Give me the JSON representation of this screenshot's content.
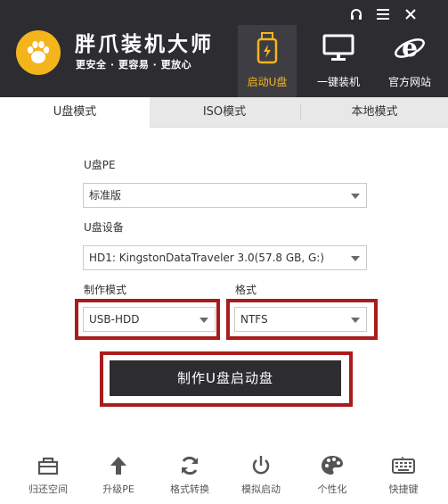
{
  "app": {
    "title": "胖爪装机大师",
    "tagline": "更安全 · 更容易 · 更放心",
    "brand_color": "#f3b51b",
    "header_color": "#2d2c31"
  },
  "window_controls": [
    {
      "icon": "headset-icon"
    },
    {
      "icon": "menu-icon"
    },
    {
      "icon": "close-icon"
    }
  ],
  "nav": [
    {
      "label": "启动U盘",
      "icon": "usb-drive-icon",
      "active": true
    },
    {
      "label": "一键装机",
      "icon": "monitor-icon",
      "active": false
    },
    {
      "label": "官方网站",
      "icon": "ie-browser-icon",
      "active": false
    }
  ],
  "tabs": [
    {
      "label": "U盘模式",
      "active": true
    },
    {
      "label": "ISO模式",
      "active": false
    },
    {
      "label": "本地模式",
      "active": false
    }
  ],
  "form": {
    "pe_label": "U盘PE",
    "pe_value": "标准版",
    "device_label": "U盘设备",
    "device_value": "HD1: KingstonDataTraveler 3.0(57.8 GB, G:)",
    "mode_label": "制作模式",
    "mode_value": "USB-HDD",
    "format_label": "格式",
    "format_value": "NTFS",
    "highlight_color": "#a81c1c"
  },
  "make_button": "制作U盘启动盘",
  "tools": [
    {
      "label": "归还空间",
      "icon": "restore-space-icon"
    },
    {
      "label": "升级PE",
      "icon": "upgrade-arrow-icon"
    },
    {
      "label": "格式转换",
      "icon": "convert-refresh-icon"
    },
    {
      "label": "模拟启动",
      "icon": "power-icon"
    },
    {
      "label": "个性化",
      "icon": "palette-icon"
    },
    {
      "label": "快捷键",
      "icon": "keyboard-icon"
    }
  ]
}
